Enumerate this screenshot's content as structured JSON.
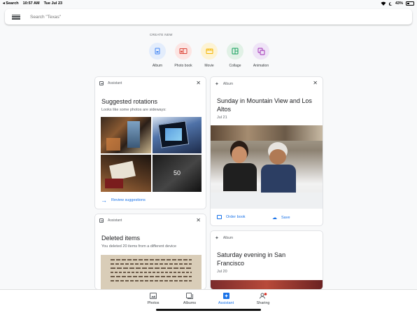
{
  "status_bar": {
    "back_label": "◂ Search",
    "time": "10:57 AM",
    "date": "Tue Jul 23",
    "battery": "43%",
    "battery_level": 0.43
  },
  "search": {
    "placeholder": "Search \"Texas\""
  },
  "create_new": {
    "label": "CREATE NEW",
    "items": [
      {
        "label": "Album",
        "icon": "album-icon",
        "bg": "#e3edfc",
        "color": "#4285f4"
      },
      {
        "label": "Photo book",
        "icon": "photo-book-icon",
        "bg": "#fce5e3",
        "color": "#db4437"
      },
      {
        "label": "Movie",
        "icon": "movie-icon",
        "bg": "#fdf3d3",
        "color": "#f4b400"
      },
      {
        "label": "Collage",
        "icon": "collage-icon",
        "bg": "#e1f1e6",
        "color": "#0f9d58"
      },
      {
        "label": "Animation",
        "icon": "animation-icon",
        "bg": "#efe4f7",
        "color": "#9c27b0"
      }
    ]
  },
  "cards": {
    "rotations": {
      "tag": "Assistant",
      "title": "Suggested rotations",
      "subtitle": "Looks like some photos are sideways:",
      "more_count": "50",
      "action": "Review suggestions"
    },
    "deleted": {
      "tag": "Assistant",
      "title": "Deleted items",
      "subtitle": "You deleted 20 items from a different device"
    },
    "mountain_view": {
      "tag": "Album",
      "title": "Sunday in Mountain View and Los Altos",
      "date": "Jul 21",
      "action_order": "Order book",
      "action_save": "Save"
    },
    "san_francisco": {
      "tag": "Album",
      "title": "Saturday evening in San Francisco",
      "date": "Jul 20"
    }
  },
  "bottom_nav": [
    {
      "label": "Photos",
      "icon": "photos-icon",
      "active": false
    },
    {
      "label": "Albums",
      "icon": "albums-icon",
      "active": false
    },
    {
      "label": "Assistant",
      "icon": "assistant-icon",
      "active": true
    },
    {
      "label": "Sharing",
      "icon": "sharing-icon",
      "active": false
    }
  ],
  "colors": {
    "accent": "#1a73e8",
    "notification": "#d93025"
  }
}
